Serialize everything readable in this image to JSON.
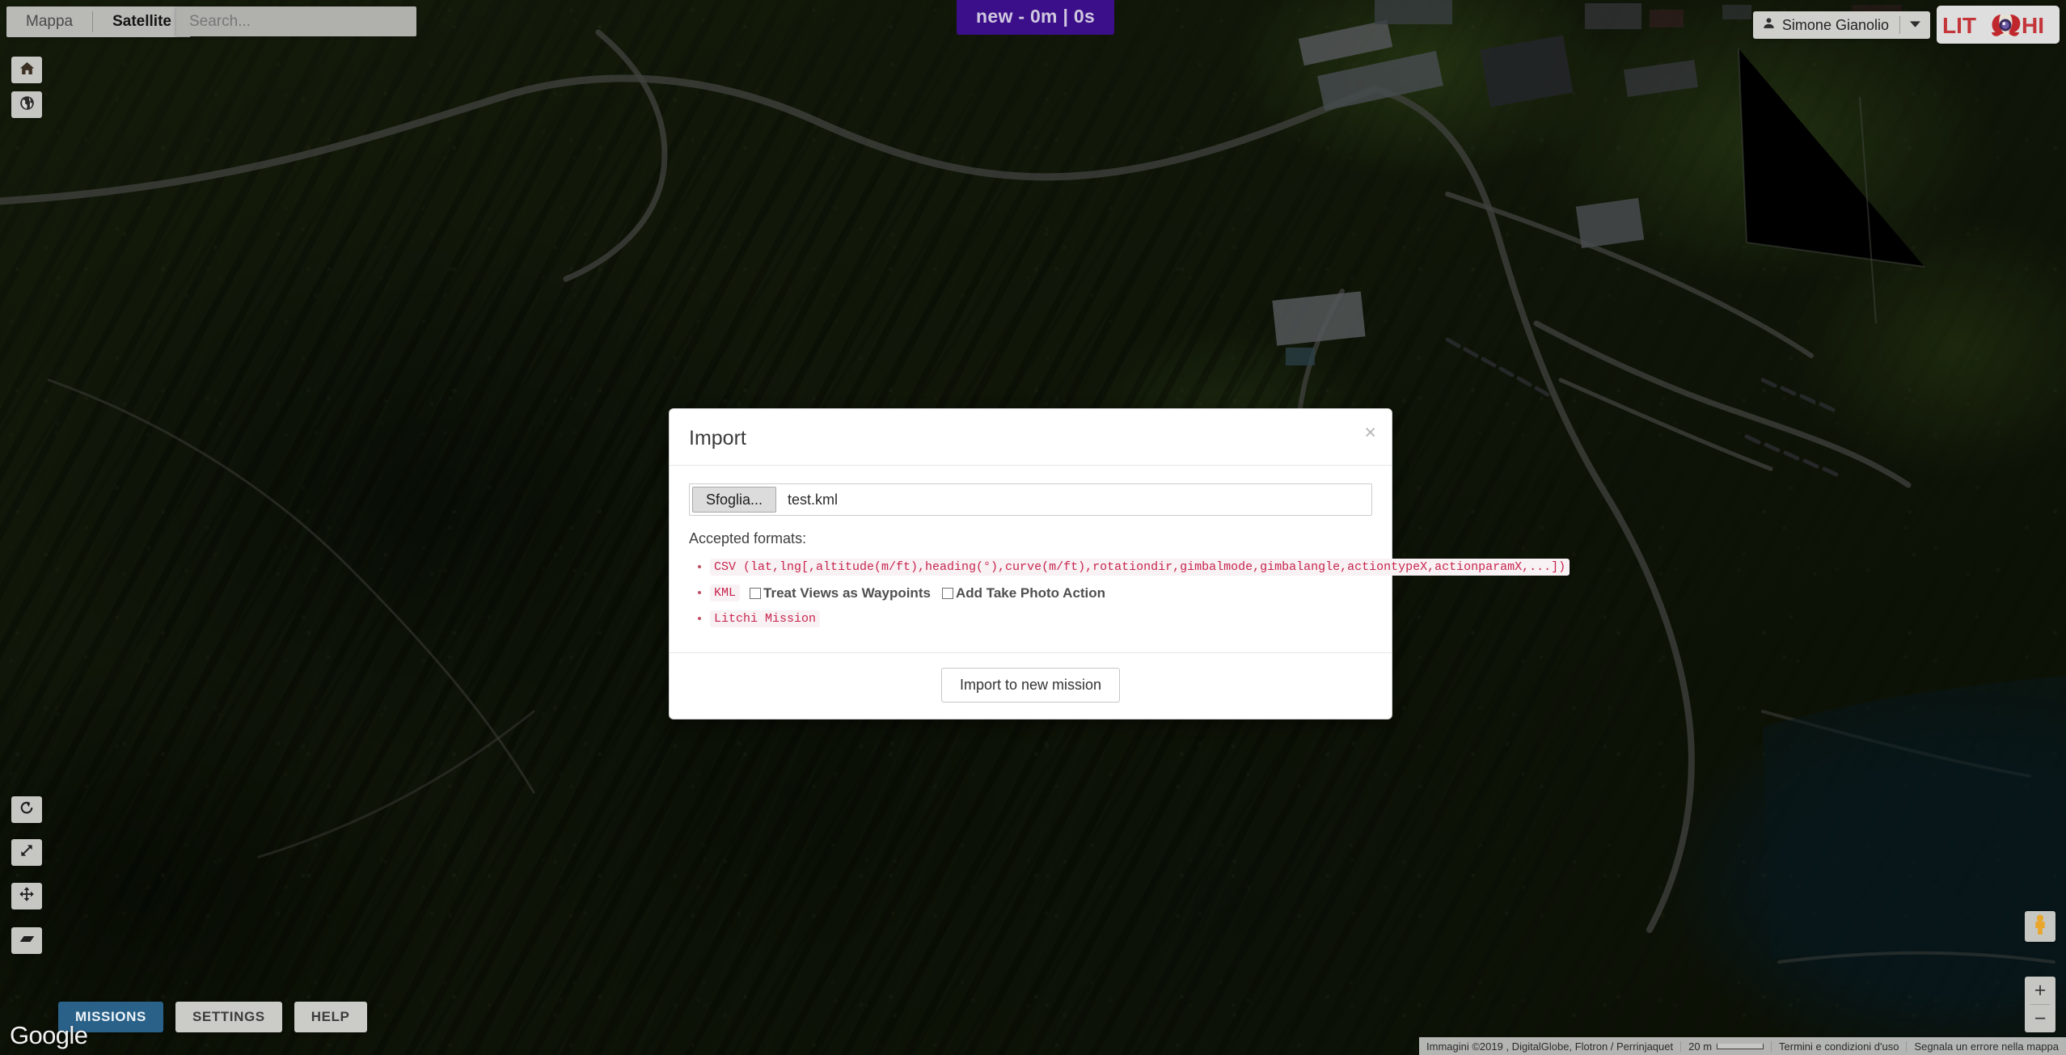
{
  "topbar": {
    "maptype": {
      "map_label": "Mappa",
      "satellite_label": "Satellite",
      "active": "Satellite"
    },
    "search": {
      "value": "",
      "placeholder": "Search..."
    },
    "mission_badge": "new - 0m | 0s",
    "user": {
      "name": "Simone Gianolio",
      "avatar_icon": "person-icon",
      "caret_icon": "chevron-down-icon"
    },
    "brand": {
      "text_left": "LIT",
      "text_right": "HI",
      "full": "LITCHI",
      "logo_icon": "litchi-fruit-icon"
    }
  },
  "left_controls": [
    {
      "name": "home",
      "icon": "home-icon"
    },
    {
      "name": "globe",
      "icon": "globe-icon"
    }
  ],
  "edit_tools": [
    {
      "name": "rotate",
      "icon": "rotate-icon"
    },
    {
      "name": "resize",
      "icon": "resize-diagonal-icon"
    },
    {
      "name": "move",
      "icon": "move-arrows-icon"
    },
    {
      "name": "skew",
      "icon": "skew-plane-icon"
    }
  ],
  "bottom_tabs": [
    {
      "label": "MISSIONS",
      "active": true
    },
    {
      "label": "SETTINGS",
      "active": false
    },
    {
      "label": "HELP",
      "active": false
    }
  ],
  "map_controls": {
    "google_logo": "Google",
    "pegman_icon": "street-view-pegman-icon",
    "zoom_in": "+",
    "zoom_out": "−"
  },
  "attribution": {
    "imagery": "Immagini ©2019 , DigitalGlobe, Flotron / Perrinjaquet",
    "scale": "20 m",
    "terms": "Termini e condizioni d'uso",
    "report": "Segnala un errore nella mappa"
  },
  "modal": {
    "title": "Import",
    "close_icon": "close-icon",
    "close_label": "×",
    "file": {
      "browse_label": "Sfoglia...",
      "filename": "test.kml"
    },
    "accepted_label": "Accepted formats:",
    "formats": [
      {
        "code": "CSV (lat,lng[,altitude(m/ft),heading(°),curve(m/ft),rotationdir,gimbalmode,gimbalangle,actiontypeX,actionparamX,...])",
        "options": []
      },
      {
        "code": "KML",
        "options": [
          {
            "label": "Treat Views as Waypoints",
            "checked": false
          },
          {
            "label": "Add Take Photo Action",
            "checked": false
          }
        ]
      },
      {
        "code": "Litchi Mission",
        "options": []
      }
    ],
    "submit_label": "Import to new mission"
  },
  "colors": {
    "accent_purple": "#3c0f8a",
    "tab_active_blue": "#2a6189",
    "code_pink": "#c7254e",
    "code_bg": "#f9f2f4",
    "brand_red": "#c4353a"
  }
}
